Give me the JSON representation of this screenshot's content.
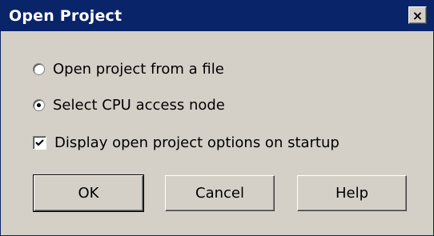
{
  "window": {
    "title": "Open Project",
    "close_glyph": "×"
  },
  "options": {
    "open_from_file": {
      "label": "Open project from a file",
      "selected": false
    },
    "select_cpu_node": {
      "label": "Select CPU access node",
      "selected": true
    },
    "display_on_startup": {
      "label": "Display open project options on startup",
      "checked": true
    }
  },
  "buttons": {
    "ok": "OK",
    "cancel": "Cancel",
    "help": "Help"
  }
}
